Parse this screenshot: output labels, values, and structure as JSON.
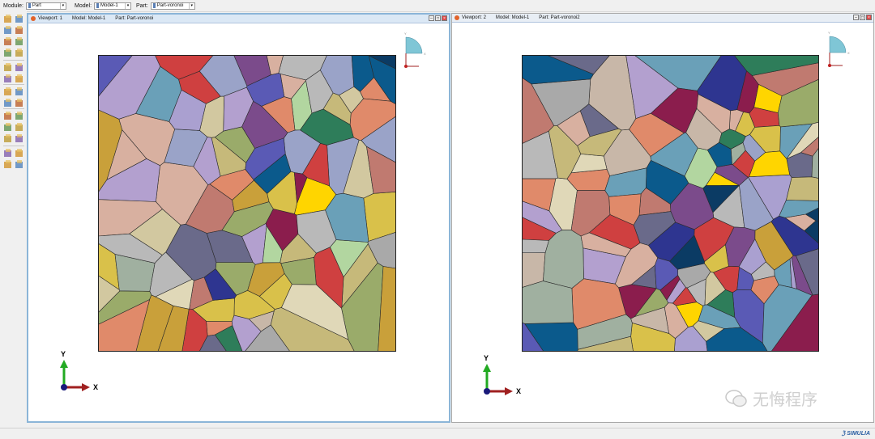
{
  "context_bar": {
    "module_label": "Module:",
    "module_value": "Part",
    "model_label": "Model:",
    "model_value": "Model-1",
    "part_label": "Part:",
    "part_value": "Part-voronoi"
  },
  "viewports": [
    {
      "title_label": "Viewport: 1",
      "model_text": "Model-1",
      "part_text": "Part-voronoi",
      "model_prefix": "Model:",
      "part_prefix": "Part:"
    },
    {
      "title_label": "Viewport: 2",
      "model_text": "Model-1",
      "part_text": "Part-voronoi2",
      "model_prefix": "Model:",
      "part_prefix": "Part:"
    }
  ],
  "triad": {
    "x_label": "X",
    "y_label": "Y"
  },
  "view_cube": {
    "x_label": "X",
    "y_label": "Y"
  },
  "branding": {
    "simulia": "SIMULIA"
  },
  "watermark": {
    "text": "无悔程序"
  },
  "colors": {
    "palette": [
      "#2e3590",
      "#8b1d4d",
      "#2e7d5a",
      "#0b5a8c",
      "#c9a03a",
      "#d2c8a0",
      "#a9a9a9",
      "#5a5ab5",
      "#e08a6a",
      "#b9b9b9",
      "#c07a70",
      "#9aab6a",
      "#c8b7a8",
      "#0b3b64",
      "#b3a0cf",
      "#e0d8b8",
      "#cf4040",
      "#7b4b8b",
      "#ffd500",
      "#9aa3c8",
      "#d9c14a",
      "#a0b0a0",
      "#aaa0d0",
      "#c6b97a",
      "#d8b0a0",
      "#6aa0b8",
      "#b2d6a0",
      "#6a6a8a"
    ]
  }
}
